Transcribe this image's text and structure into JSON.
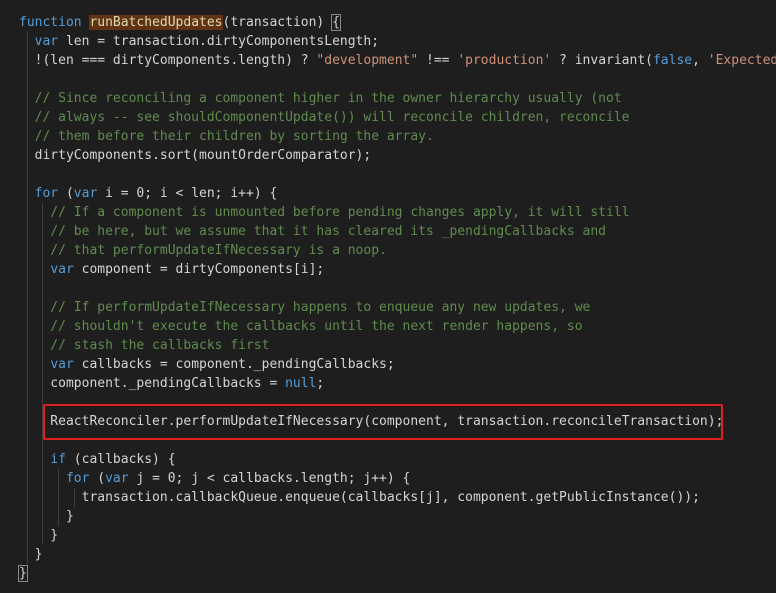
{
  "editor": {
    "lines": [
      [
        {
          "t": "function",
          "c": "kw"
        },
        {
          "t": " ",
          "c": "plain"
        },
        {
          "t": "runBatchedUpdates",
          "c": "fnhl"
        },
        {
          "t": "(transaction) ",
          "c": "plain"
        },
        {
          "t": "{",
          "c": "brace-open"
        }
      ],
      [
        {
          "t": "  ",
          "c": "plain"
        },
        {
          "t": "var",
          "c": "kw"
        },
        {
          "t": " len = transaction.dirtyComponentsLength;",
          "c": "plain"
        }
      ],
      [
        {
          "t": "  !(len === dirtyComponents.length) ? ",
          "c": "plain"
        },
        {
          "t": "\"development\"",
          "c": "str"
        },
        {
          "t": " !== ",
          "c": "plain"
        },
        {
          "t": "'production'",
          "c": "str"
        },
        {
          "t": " ? invariant(",
          "c": "plain"
        },
        {
          "t": "false",
          "c": "kw"
        },
        {
          "t": ", ",
          "c": "plain"
        },
        {
          "t": "'Expected ",
          "c": "str"
        }
      ],
      [
        {
          "t": "",
          "c": "plain"
        }
      ],
      [
        {
          "t": "  // Since reconciling a component higher in the owner hierarchy usually (not",
          "c": "cm"
        }
      ],
      [
        {
          "t": "  // always -- see shouldComponentUpdate()) will reconcile children, reconcile",
          "c": "cm"
        }
      ],
      [
        {
          "t": "  // them before their children by sorting the array.",
          "c": "cm"
        }
      ],
      [
        {
          "t": "  dirtyComponents.sort(mountOrderComparator);",
          "c": "plain"
        }
      ],
      [
        {
          "t": "",
          "c": "plain"
        }
      ],
      [
        {
          "t": "  ",
          "c": "plain"
        },
        {
          "t": "for",
          "c": "kw"
        },
        {
          "t": " (",
          "c": "plain"
        },
        {
          "t": "var",
          "c": "kw"
        },
        {
          "t": " i = 0; i < len; i++) {",
          "c": "plain"
        }
      ],
      [
        {
          "t": "    // If a component is unmounted before pending changes apply, it will still",
          "c": "cm"
        }
      ],
      [
        {
          "t": "    // be here, but we assume that it has cleared its _pendingCallbacks and",
          "c": "cm"
        }
      ],
      [
        {
          "t": "    // that performUpdateIfNecessary is a noop.",
          "c": "cm"
        }
      ],
      [
        {
          "t": "    ",
          "c": "plain"
        },
        {
          "t": "var",
          "c": "kw"
        },
        {
          "t": " component = dirtyComponents[i];",
          "c": "plain"
        }
      ],
      [
        {
          "t": "",
          "c": "plain"
        }
      ],
      [
        {
          "t": "    // If performUpdateIfNecessary happens to enqueue any new updates, we",
          "c": "cm"
        }
      ],
      [
        {
          "t": "    // shouldn't execute the callbacks until the next render happens, so",
          "c": "cm"
        }
      ],
      [
        {
          "t": "    // stash the callbacks first",
          "c": "cm"
        }
      ],
      [
        {
          "t": "    ",
          "c": "plain"
        },
        {
          "t": "var",
          "c": "kw"
        },
        {
          "t": " callbacks = component._pendingCallbacks;",
          "c": "plain"
        }
      ],
      [
        {
          "t": "    component._pendingCallbacks = ",
          "c": "plain"
        },
        {
          "t": "null",
          "c": "kw"
        },
        {
          "t": ";",
          "c": "plain"
        }
      ],
      [
        {
          "t": "",
          "c": "plain"
        }
      ],
      [
        {
          "t": "    ReactReconciler.performUpdateIfNecessary(component, transaction.reconcileTransaction);",
          "c": "plain"
        }
      ],
      [
        {
          "t": "",
          "c": "plain"
        }
      ],
      [
        {
          "t": "    ",
          "c": "plain"
        },
        {
          "t": "if",
          "c": "kw"
        },
        {
          "t": " (callbacks) {",
          "c": "plain"
        }
      ],
      [
        {
          "t": "      ",
          "c": "plain"
        },
        {
          "t": "for",
          "c": "kw"
        },
        {
          "t": " (",
          "c": "plain"
        },
        {
          "t": "var",
          "c": "kw"
        },
        {
          "t": " j = 0; j < callbacks.length; j++) {",
          "c": "plain"
        }
      ],
      [
        {
          "t": "        transaction.callbackQueue.enqueue(callbacks[j], component.getPublicInstance());",
          "c": "plain"
        }
      ],
      [
        {
          "t": "      }",
          "c": "plain"
        }
      ],
      [
        {
          "t": "    }",
          "c": "plain"
        }
      ],
      [
        {
          "t": "  }",
          "c": "plain"
        }
      ],
      [
        {
          "t": "}",
          "c": "brace-close"
        }
      ]
    ]
  },
  "colors": {
    "background": "#1e1e1e",
    "keyword": "#569cd6",
    "function": "#dcdcaa",
    "string": "#ce9178",
    "comment": "#608b4e",
    "text": "#d4d4d4",
    "highlight_box": "#e02020"
  }
}
